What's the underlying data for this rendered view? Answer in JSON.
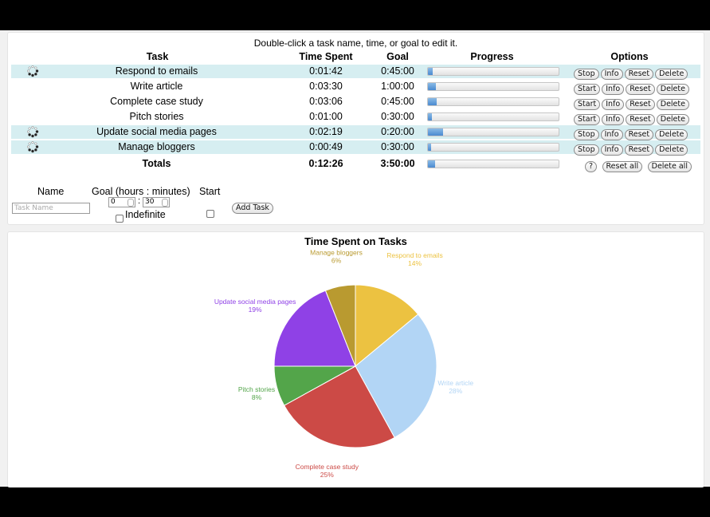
{
  "hint": "Double-click a task name, time, or goal to edit it.",
  "columns": {
    "task": "Task",
    "time": "Time Spent",
    "goal": "Goal",
    "progress": "Progress",
    "options": "Options"
  },
  "tasks": [
    {
      "name": "Respond to emails",
      "time": "0:01:42",
      "goal": "0:45:00",
      "progress": 0.038,
      "running": true,
      "toggle": "Stop"
    },
    {
      "name": "Write article",
      "time": "0:03:30",
      "goal": "1:00:00",
      "progress": 0.058,
      "running": false,
      "toggle": "Start"
    },
    {
      "name": "Complete case study",
      "time": "0:03:06",
      "goal": "0:45:00",
      "progress": 0.069,
      "running": false,
      "toggle": "Start"
    },
    {
      "name": "Pitch stories",
      "time": "0:01:00",
      "goal": "0:30:00",
      "progress": 0.033,
      "running": false,
      "toggle": "Start"
    },
    {
      "name": "Update social media pages",
      "time": "0:02:19",
      "goal": "0:20:00",
      "progress": 0.116,
      "running": true,
      "toggle": "Stop"
    },
    {
      "name": "Manage bloggers",
      "time": "0:00:49",
      "goal": "0:30:00",
      "progress": 0.027,
      "running": true,
      "toggle": "Stop"
    }
  ],
  "row_buttons": {
    "info": "Info",
    "reset": "Reset",
    "delete": "Delete"
  },
  "totals": {
    "label": "Totals",
    "time": "0:12:26",
    "goal": "3:50:00",
    "progress": 0.054,
    "help": "?",
    "reset_all": "Reset all",
    "delete_all": "Delete all"
  },
  "add_form": {
    "name_label": "Name",
    "goal_label": "Goal (hours : minutes)",
    "start_label": "Start",
    "name_placeholder": "Task Name",
    "hours": "0",
    "separator": ":",
    "minutes": "30",
    "indefinite_label": "Indefinite",
    "add_button": "Add Task"
  },
  "icons": {
    "running": "spinner-icon"
  },
  "chart_data": {
    "type": "pie",
    "title": "Time Spent on Tasks",
    "labels": [
      "Respond to emails",
      "Write article",
      "Complete case study",
      "Pitch stories",
      "Update social media pages",
      "Manage bloggers"
    ],
    "values": [
      14,
      28,
      25,
      8,
      19,
      6
    ],
    "value_labels": [
      "14%",
      "28%",
      "25%",
      "8%",
      "19%",
      "6%"
    ],
    "colors": [
      "#ecc241",
      "#b2d5f5",
      "#cc4a46",
      "#53a54a",
      "#8f41e6",
      "#b99a30"
    ],
    "start": "top",
    "direction": "clockwise"
  }
}
